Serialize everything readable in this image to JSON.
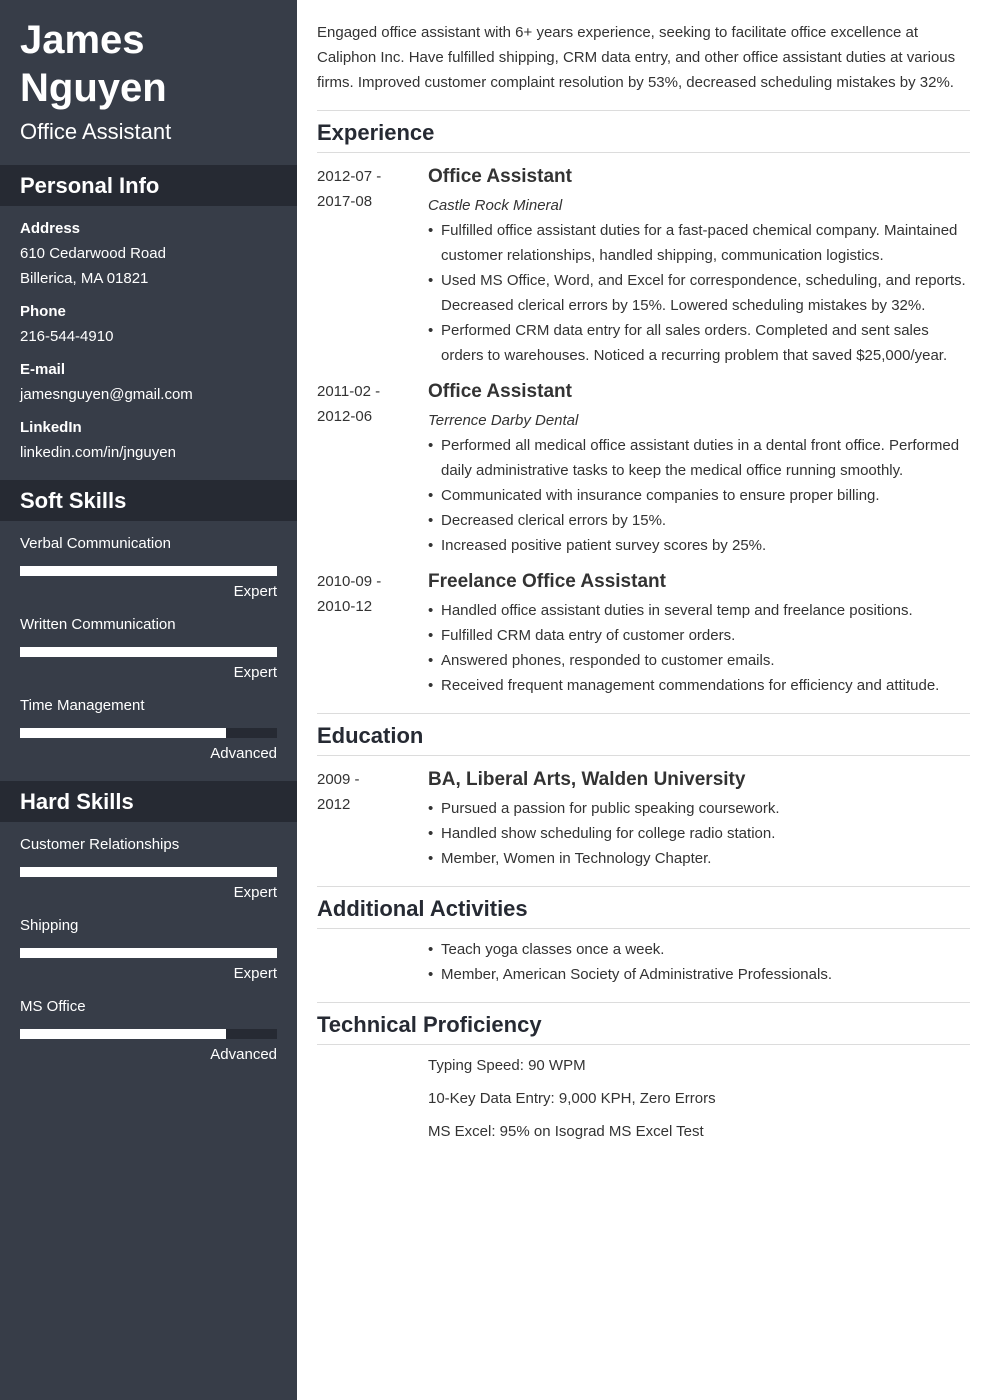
{
  "header": {
    "name_line1": "James",
    "name_line2": "Nguyen",
    "title": "Office Assistant"
  },
  "personal_info": {
    "heading": "Personal Info",
    "address_label": "Address",
    "address_line1": "610 Cedarwood Road",
    "address_line2": "Billerica, MA 01821",
    "phone_label": "Phone",
    "phone": "216-544-4910",
    "email_label": "E-mail",
    "email": "jamesnguyen@gmail.com",
    "linkedin_label": "LinkedIn",
    "linkedin": "linkedin.com/in/jnguyen"
  },
  "soft_skills": {
    "heading": "Soft Skills",
    "items": [
      {
        "name": "Verbal Communication",
        "level": "Expert",
        "fill_percent": 100
      },
      {
        "name": "Written Communication",
        "level": "Expert",
        "fill_percent": 100
      },
      {
        "name": "Time Management",
        "level": "Advanced",
        "fill_percent": 80
      }
    ]
  },
  "hard_skills": {
    "heading": "Hard Skills",
    "items": [
      {
        "name": "Customer Relationships",
        "level": "Expert",
        "fill_percent": 100
      },
      {
        "name": "Shipping",
        "level": "Expert",
        "fill_percent": 100
      },
      {
        "name": "MS Office",
        "level": "Advanced",
        "fill_percent": 80
      }
    ]
  },
  "summary": "Engaged office assistant with 6+ years experience, seeking to facilitate office excellence at Caliphon Inc. Have fulfilled shipping, CRM data entry, and other office assistant duties at various firms. Improved customer complaint resolution by 53%, decreased scheduling mistakes by 32%.",
  "experience": {
    "heading": "Experience",
    "entries": [
      {
        "date_start": "2012-07 -",
        "date_end": "2017-08",
        "title": "Office Assistant",
        "company": "Castle Rock Mineral",
        "bullets": [
          "Fulfilled office assistant duties for a fast-paced chemical company. Maintained customer relationships, handled shipping, communication logistics.",
          "Used MS Office, Word, and Excel for correspondence, scheduling, and reports. Decreased clerical errors by 15%. Lowered scheduling mistakes by 32%.",
          "Performed CRM data entry for all sales orders. Completed and sent sales orders to warehouses. Noticed a recurring problem that saved $25,000/year."
        ]
      },
      {
        "date_start": "2011-02 -",
        "date_end": "2012-06",
        "title": "Office Assistant",
        "company": "Terrence Darby Dental",
        "bullets": [
          "Performed all medical office assistant duties in a dental front office. Performed daily administrative tasks to keep the medical office running smoothly.",
          "Communicated with insurance companies to ensure proper billing.",
          "Decreased clerical errors by 15%.",
          "Increased positive patient survey scores by 25%."
        ]
      },
      {
        "date_start": "2010-09 -",
        "date_end": "2010-12",
        "title": "Freelance Office Assistant",
        "bullets": [
          "Handled office assistant duties in several temp and freelance positions.",
          "Fulfilled CRM data entry of customer orders.",
          "Answered phones, responded to customer emails.",
          "Received frequent management commendations for efficiency and attitude."
        ]
      }
    ]
  },
  "education": {
    "heading": "Education",
    "entries": [
      {
        "date_start": "2009 -",
        "date_end": "2012",
        "title": "BA, Liberal Arts, Walden University",
        "bullets": [
          "Pursued a passion for public speaking coursework.",
          "Handled show scheduling for college radio station.",
          "Member, Women in Technology Chapter."
        ]
      }
    ]
  },
  "additional_activities": {
    "heading": "Additional Activities",
    "bullets": [
      "Teach yoga classes once a week.",
      "Member, American Society of Administrative Professionals."
    ]
  },
  "technical_proficiency": {
    "heading": "Technical Proficiency",
    "items": [
      "Typing Speed: 90 WPM",
      "10-Key Data Entry: 9,000 KPH, Zero Errors",
      "MS Excel: 95% on Isograd MS Excel Test"
    ]
  },
  "colors": {
    "sidebar_bg": "#373d48",
    "sidebar_heading_bg": "#262a33",
    "text": "#333333",
    "heading_text": "#262a33",
    "rule": "#dcdcdc"
  }
}
